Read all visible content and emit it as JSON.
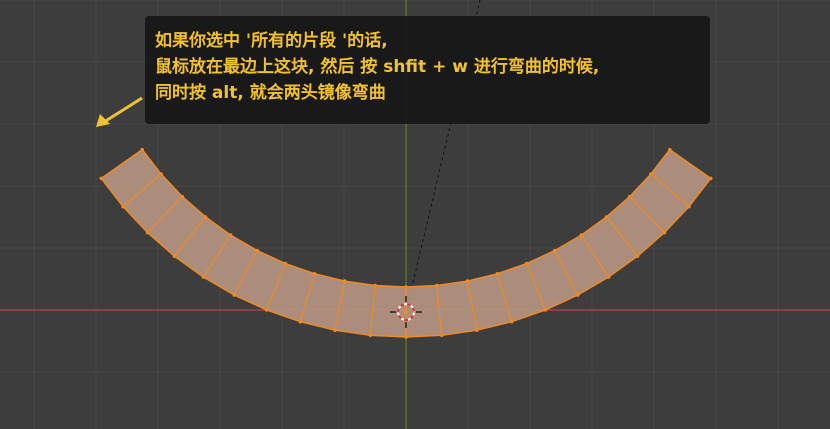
{
  "viewport": {
    "background": "#3d3d3d",
    "grid_color": "#474747",
    "x_axis_color": "#b54550",
    "y_axis_color": "#5f7f2e",
    "mesh_face_color": "#b89682",
    "mesh_edge_color": "#f08a24"
  },
  "tooltip": {
    "lines": [
      "如果你选中 '所有的片段 '的话,",
      "鼠标放在最边上这块, 然后 按 shfit + w 进行弯曲的时候,",
      "同时按 alt, 就会两头镜像弯曲"
    ],
    "text_color": "#f2c12e",
    "arrow_color": "#f2c12e"
  },
  "icons": {
    "pivot": "3d-cursor-icon"
  }
}
